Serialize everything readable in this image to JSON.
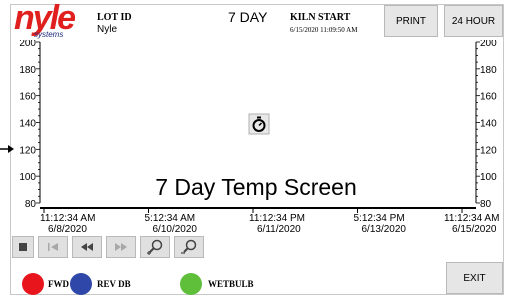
{
  "logo": {
    "word": "nyle",
    "subtitle": "systems"
  },
  "header": {
    "lot_label": "LOT ID",
    "lot_value": "Nyle",
    "range_label": "7 DAY",
    "kiln_label": "KILN START",
    "kiln_value": "6/15/2020 11:09:50 AM"
  },
  "buttons": {
    "print": "PRINT",
    "range_24": "24 HOUR",
    "exit": "EXIT"
  },
  "chart_data": {
    "type": "line",
    "title": "7 Day Temp Screen",
    "y_ticks": [
      "200",
      "180",
      "160",
      "140",
      "120",
      "100",
      "80"
    ],
    "ylim": [
      80,
      200
    ],
    "x_labels": [
      {
        "time": "11:12:34 AM",
        "date": "6/8/2020"
      },
      {
        "time": "5:12:34 AM",
        "date": "6/10/2020"
      },
      {
        "time": "11:12:34 PM",
        "date": "6/11/2020"
      },
      {
        "time": "5:12:34 PM",
        "date": "6/13/2020"
      },
      {
        "time": "11:12:34 AM",
        "date": "6/15/2020"
      }
    ],
    "series": [
      {
        "name": "FWD DB",
        "color": "#e8161c",
        "values": []
      },
      {
        "name": "REV DB",
        "color": "#2f47a8",
        "values": []
      },
      {
        "name": "WETBULB",
        "color": "#5fbf3a",
        "values": []
      }
    ]
  },
  "toolbar": {
    "icons": [
      "stop-icon",
      "skip-back-icon",
      "rewind-icon",
      "fast-forward-icon",
      "zoom-in-icon",
      "zoom-out-icon"
    ],
    "center_icon": "stopwatch-icon"
  }
}
